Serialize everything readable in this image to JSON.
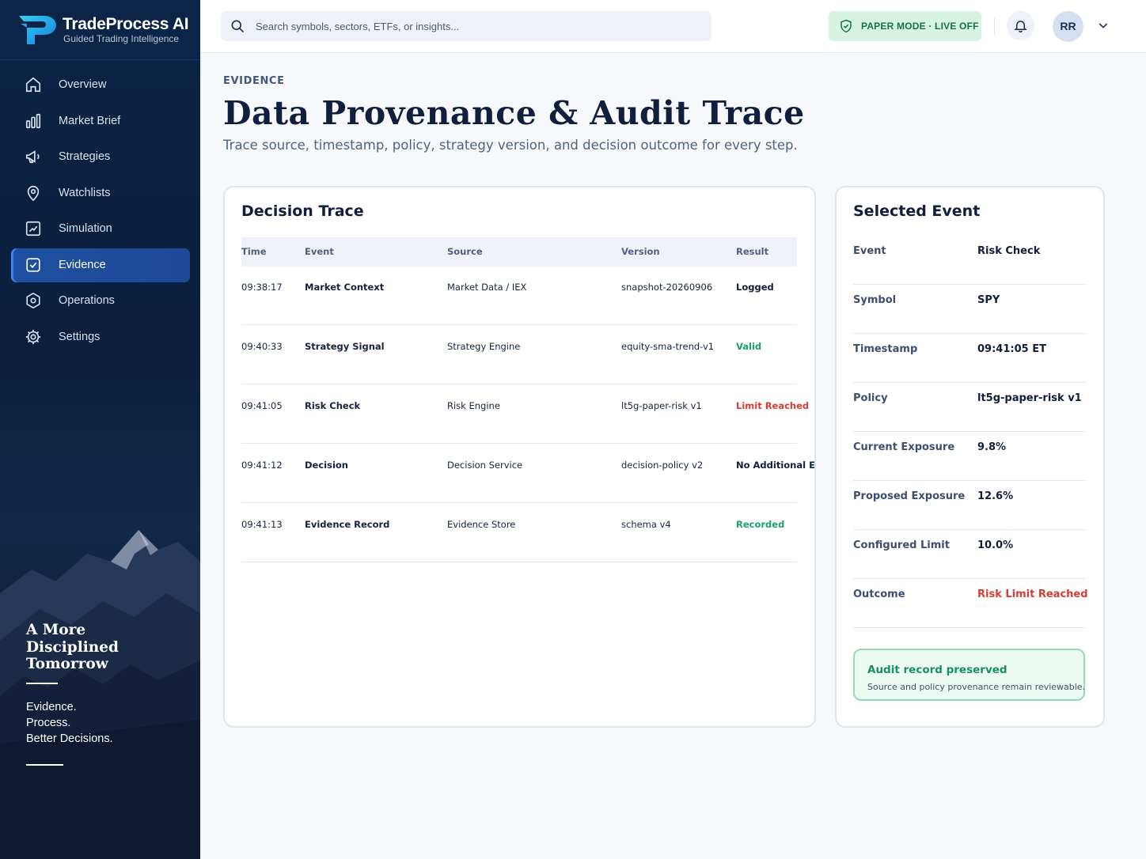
{
  "brand": {
    "name": "TradeProcess AI",
    "tagline": "Guided Trading Intelligence"
  },
  "sidebar": {
    "items": [
      {
        "label": "Overview",
        "icon": "home-icon"
      },
      {
        "label": "Market Brief",
        "icon": "bar-chart-icon"
      },
      {
        "label": "Strategies",
        "icon": "megaphone-icon"
      },
      {
        "label": "Watchlists",
        "icon": "location-pin-icon"
      },
      {
        "label": "Simulation",
        "icon": "chart-frame-icon"
      },
      {
        "label": "Evidence",
        "icon": "shield-check-icon",
        "active": true
      },
      {
        "label": "Operations",
        "icon": "hexagon-gear-icon"
      },
      {
        "label": "Settings",
        "icon": "gear-icon"
      }
    ],
    "tagline": [
      "A More",
      "Disciplined",
      "Tomorrow"
    ],
    "sub_tagline": [
      "Evidence.",
      "Process.",
      "Better Decisions."
    ]
  },
  "topbar": {
    "search_placeholder": "Search symbols, sectors, ETFs, or insights...",
    "mode": "PAPER MODE · LIVE OFF",
    "avatar_initials": "RR"
  },
  "page": {
    "eyebrow": "EVIDENCE",
    "title": "Data Provenance & Audit Trace",
    "subtitle": "Trace source, timestamp, policy, strategy version, and decision outcome for every step."
  },
  "trace": {
    "title": "Decision Trace",
    "columns": [
      "Time",
      "Event",
      "Source",
      "Version",
      "Result"
    ],
    "rows": [
      {
        "time": "09:38:17",
        "event": "Market Context",
        "source": "Market Data / IEX",
        "version": "snapshot-20260906",
        "result": "Logged",
        "status": "logged"
      },
      {
        "time": "09:40:33",
        "event": "Strategy Signal",
        "source": "Strategy Engine",
        "version": "equity-sma-trend-v1",
        "result": "Valid",
        "status": "valid"
      },
      {
        "time": "09:41:05",
        "event": "Risk Check",
        "source": "Risk Engine",
        "version": "lt5g-paper-risk v1",
        "result": "Limit Reached",
        "status": "limit"
      },
      {
        "time": "09:41:12",
        "event": "Decision",
        "source": "Decision Service",
        "version": "decision-policy v2",
        "result": "No Additional Expos",
        "status": "none"
      },
      {
        "time": "09:41:13",
        "event": "Evidence Record",
        "source": "Evidence Store",
        "version": "schema v4",
        "result": "Recorded",
        "status": "rec"
      }
    ]
  },
  "selected": {
    "title": "Selected Event",
    "fields": [
      {
        "key": "Event",
        "value": "Risk Check"
      },
      {
        "key": "Symbol",
        "value": "SPY"
      },
      {
        "key": "Timestamp",
        "value": "09:41:05 ET"
      },
      {
        "key": "Policy",
        "value": "lt5g-paper-risk v1"
      },
      {
        "key": "Current Exposure",
        "value": "9.8%"
      },
      {
        "key": "Proposed Exposure",
        "value": "12.6%"
      },
      {
        "key": "Configured Limit",
        "value": "10.0%"
      },
      {
        "key": "Outcome",
        "value": "Risk Limit Reached",
        "status": "red"
      }
    ],
    "audit_title": "Audit record preserved",
    "audit_sub": "Source and policy provenance remain reviewable."
  },
  "colors": {
    "accent": "#1e4fa0",
    "success": "#1aa06a",
    "danger": "#d63c36",
    "navy": "#0b2447"
  }
}
